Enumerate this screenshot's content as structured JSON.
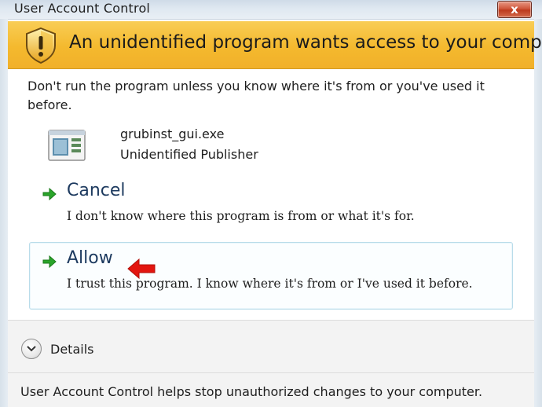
{
  "window": {
    "title": "User Account Control",
    "close_label": "x"
  },
  "banner": {
    "icon": "shield-warning-icon",
    "text": "An unidentified program wants access to your computer",
    "color": "#f4b92e"
  },
  "body": {
    "warning": "Don't run the program unless you know where it's from or you've used it before."
  },
  "program": {
    "icon": "program-icon",
    "name": "grubinst_gui.exe",
    "publisher": "Unidentified Publisher"
  },
  "choices": [
    {
      "title": "Cancel",
      "description": "I don't know where this program is from or what it's for.",
      "icon": "green-arrow-icon"
    },
    {
      "title": "Allow",
      "description": "I trust this program. I know where it's from or I've used it before.",
      "icon": "green-arrow-icon",
      "highlight_icon": "red-arrow-icon"
    }
  ],
  "details": {
    "label": "Details",
    "icon": "chevron-down-icon"
  },
  "footer": {
    "text": "User Account Control helps stop unauthorized changes to your computer."
  }
}
